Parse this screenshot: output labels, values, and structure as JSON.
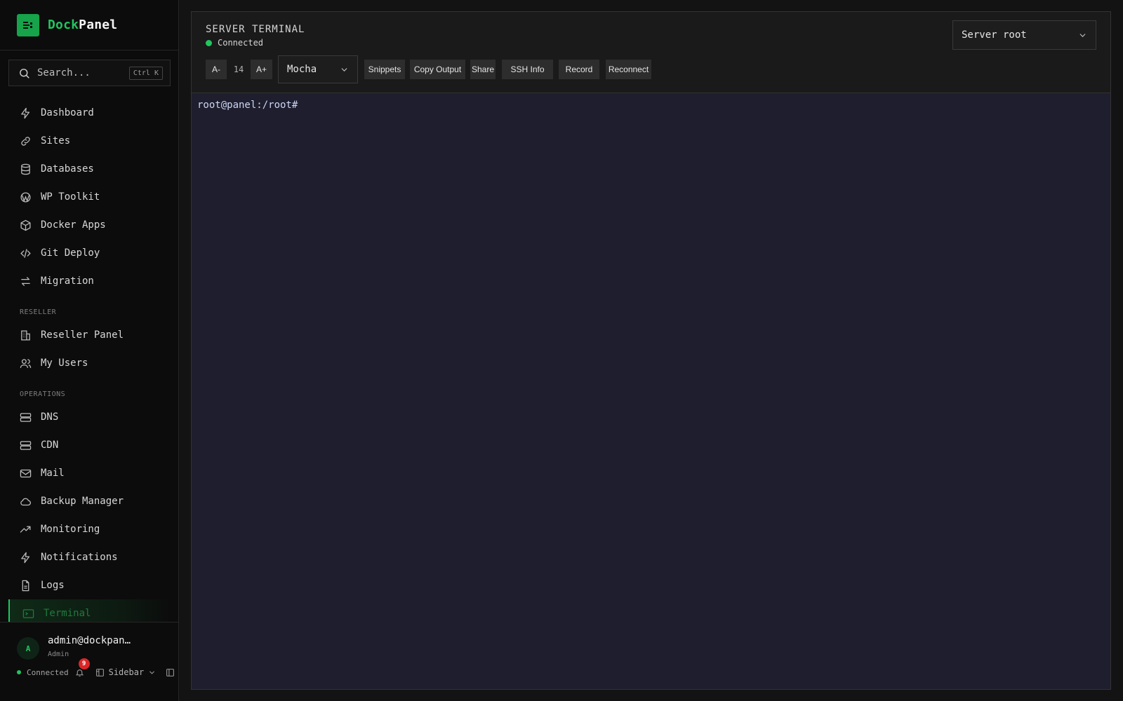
{
  "brand": {
    "name_a": "Dock",
    "name_b": "Panel",
    "accent": "#22c55e"
  },
  "search": {
    "placeholder": "Search...",
    "shortcut": "Ctrl K"
  },
  "nav": {
    "main": [
      {
        "label": "Dashboard",
        "icon": "bolt-icon"
      },
      {
        "label": "Sites",
        "icon": "link-icon"
      },
      {
        "label": "Databases",
        "icon": "database-icon"
      },
      {
        "label": "WP Toolkit",
        "icon": "wordpress-icon"
      },
      {
        "label": "Docker Apps",
        "icon": "box-icon"
      },
      {
        "label": "Git Deploy",
        "icon": "code-icon"
      },
      {
        "label": "Migration",
        "icon": "arrows-icon"
      }
    ],
    "reseller_title": "RESELLER",
    "reseller": [
      {
        "label": "Reseller Panel",
        "icon": "building-icon"
      },
      {
        "label": "My Users",
        "icon": "users-icon"
      }
    ],
    "operations_title": "OPERATIONS",
    "operations": [
      {
        "label": "DNS",
        "icon": "server-icon"
      },
      {
        "label": "CDN",
        "icon": "server-icon"
      },
      {
        "label": "Mail",
        "icon": "mail-icon"
      },
      {
        "label": "Backup Manager",
        "icon": "cloud-icon"
      },
      {
        "label": "Monitoring",
        "icon": "trend-icon"
      },
      {
        "label": "Notifications",
        "icon": "bolt-icon"
      },
      {
        "label": "Logs",
        "icon": "file-icon"
      },
      {
        "label": "Terminal",
        "icon": "terminal-icon",
        "active": true
      }
    ]
  },
  "user": {
    "initial": "A",
    "name": "admin@dockpan…",
    "role": "Admin",
    "status": "Connected",
    "notifications": "9",
    "layout_label": "Sidebar"
  },
  "terminal": {
    "title": "SERVER TERMINAL",
    "status": "Connected",
    "server_select": "Server root",
    "font_decrease": "A-",
    "font_size": "14",
    "font_increase": "A+",
    "theme": "Mocha",
    "buttons": {
      "snippets": "Snippets",
      "copy_output": "Copy Output",
      "share": "Share",
      "ssh_info": "SSH Info",
      "record": "Record",
      "reconnect": "Reconnect"
    },
    "prompt": "root@panel:/root#",
    "background": "#1e1e2e"
  }
}
